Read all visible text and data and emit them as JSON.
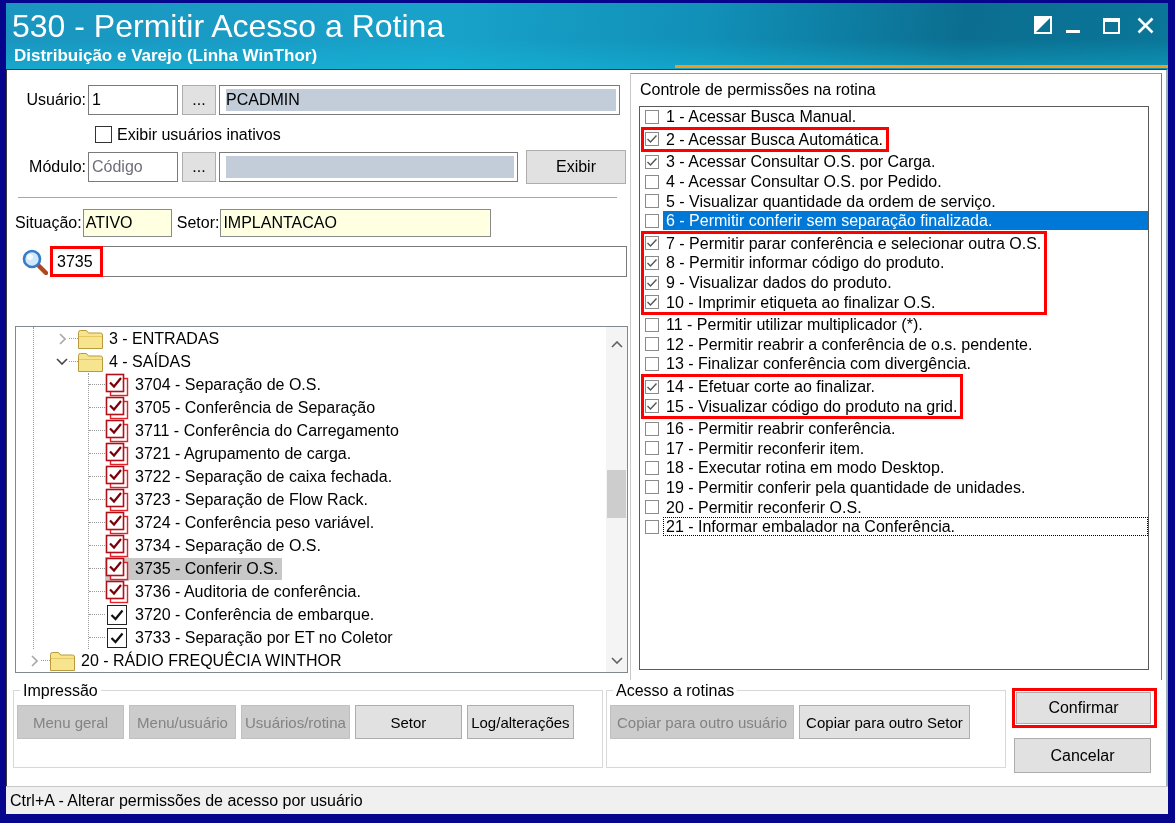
{
  "window": {
    "title": "530 - Permitir Acesso a Rotina",
    "subtitle": "Distribuição e Varejo (Linha WinThor)"
  },
  "user": {
    "label": "Usuário:",
    "code": "1",
    "lookup": "...",
    "name": "PCADMIN"
  },
  "show_inactive": {
    "label": "Exibir usuários inativos",
    "checked": false
  },
  "module": {
    "label": "Módulo:",
    "code": {
      "placeholder": "Código"
    },
    "lookup": "...",
    "show_button": "Exibir"
  },
  "situation": {
    "label": "Situação:",
    "value": "ATIVO"
  },
  "sector": {
    "label": "Setor:",
    "value": "IMPLANTACAO"
  },
  "search": {
    "value": "3735",
    "highlighted": true
  },
  "tree": {
    "items": [
      {
        "children": [
          {
            "kind": "folder",
            "label": "3 - ENTRADAS",
            "expanded": false,
            "selected": false
          },
          {
            "kind": "folder",
            "label": "4 - SAÍDAS",
            "expanded": true,
            "selected": false,
            "children": [
              {
                "kind": "double",
                "label": "3704 - Separação de O.S.",
                "checked": true,
                "selected": false
              },
              {
                "kind": "double",
                "label": "3705 - Conferência de Separação",
                "checked": true,
                "selected": false
              },
              {
                "kind": "double",
                "label": "3711 - Conferência do Carregamento",
                "checked": true,
                "selected": false
              },
              {
                "kind": "double",
                "label": "3721 - Agrupamento de carga.",
                "checked": true,
                "selected": false
              },
              {
                "kind": "double",
                "label": "3722 - Separação de caixa fechada.",
                "checked": true,
                "selected": false
              },
              {
                "kind": "double",
                "label": "3723 - Separação de Flow Rack.",
                "checked": true,
                "selected": false
              },
              {
                "kind": "double",
                "label": "3724 - Conferência peso variável.",
                "checked": true,
                "selected": false
              },
              {
                "kind": "double",
                "label": "3734 - Separação de O.S.",
                "checked": true,
                "selected": false
              },
              {
                "kind": "double",
                "label": "3735 - Conferir O.S.",
                "checked": true,
                "selected": true
              },
              {
                "kind": "double",
                "label": "3736 - Auditoria de conferência.",
                "checked": true,
                "selected": false
              },
              {
                "kind": "single",
                "label": "3720 - Conferência de embarque.",
                "checked": true,
                "selected": false
              },
              {
                "kind": "single",
                "label": "3733 - Separação por ET no Coletor",
                "checked": true,
                "selected": false
              }
            ]
          }
        ]
      },
      {
        "kind": "folder",
        "label": "20 - RÁDIO FREQUÊCIA WINTHOR",
        "expanded": false,
        "selected": false
      }
    ]
  },
  "permissions": {
    "title": "Controle de permissões na rotina",
    "items": [
      {
        "label": "1 - Acessar Busca Manual.",
        "checked": false,
        "selected": false,
        "focused": false,
        "highlighted": false
      },
      {
        "label": "2 - Acessar Busca Automática.",
        "checked": true,
        "selected": false,
        "focused": false,
        "highlighted": true
      },
      {
        "label": "3 - Acessar Consultar O.S. por Carga.",
        "checked": true,
        "selected": false,
        "focused": false,
        "highlighted": false
      },
      {
        "label": "4 - Acessar Consultar O.S. por Pedido.",
        "checked": false,
        "selected": false,
        "focused": false,
        "highlighted": false
      },
      {
        "label": "5 - Visualizar quantidade da ordem de serviço.",
        "checked": false,
        "selected": false,
        "focused": false,
        "highlighted": false
      },
      {
        "label": "6 - Permitir conferir sem separação finalizada.",
        "checked": false,
        "selected": true,
        "focused": false,
        "highlighted": false
      },
      {
        "label": "7 - Permitir parar conferência e selecionar outra O.S.",
        "checked": true,
        "selected": false,
        "focused": false,
        "highlighted": true
      },
      {
        "label": "8 - Permitir informar código do produto.",
        "checked": true,
        "selected": false,
        "focused": false,
        "highlighted": true
      },
      {
        "label": "9 - Visualizar dados do produto.",
        "checked": true,
        "selected": false,
        "focused": false,
        "highlighted": true
      },
      {
        "label": "10 - Imprimir etiqueta ao finalizar O.S.",
        "checked": true,
        "selected": false,
        "focused": false,
        "highlighted": true
      },
      {
        "label": "11 - Permitir utilizar multiplicador (*).",
        "checked": false,
        "selected": false,
        "focused": false,
        "highlighted": false
      },
      {
        "label": "12 - Permitir reabrir a conferência de o.s. pendente.",
        "checked": false,
        "selected": false,
        "focused": false,
        "highlighted": false
      },
      {
        "label": "13 - Finalizar conferência com divergência.",
        "checked": false,
        "selected": false,
        "focused": false,
        "highlighted": false
      },
      {
        "label": "14 - Efetuar corte ao finalizar.",
        "checked": true,
        "selected": false,
        "focused": false,
        "highlighted": true
      },
      {
        "label": "15 - Visualizar código do produto na grid.",
        "checked": true,
        "selected": false,
        "focused": false,
        "highlighted": true
      },
      {
        "label": "16 - Permitir reabrir conferência.",
        "checked": false,
        "selected": false,
        "focused": false,
        "highlighted": false
      },
      {
        "label": "17 - Permitir reconferir item.",
        "checked": false,
        "selected": false,
        "focused": false,
        "highlighted": false
      },
      {
        "label": "18 - Executar rotina em modo Desktop.",
        "checked": false,
        "selected": false,
        "focused": false,
        "highlighted": false
      },
      {
        "label": "19 - Permitir conferir pela quantidade de unidades.",
        "checked": false,
        "selected": false,
        "focused": false,
        "highlighted": false
      },
      {
        "label": "20 - Permitir reconferir O.S.",
        "checked": false,
        "selected": false,
        "focused": false,
        "highlighted": false
      },
      {
        "label": "21 - Informar embalador na Conferência.",
        "checked": false,
        "selected": false,
        "focused": true,
        "highlighted": false
      }
    ]
  },
  "printing": {
    "title": "Impressão",
    "buttons": [
      {
        "label": "Menu geral",
        "disabled": true
      },
      {
        "label": "Menu/usuário",
        "disabled": true
      },
      {
        "label": "Usuários/rotina",
        "disabled": true
      },
      {
        "label": "Setor",
        "disabled": false
      },
      {
        "label": "Log/alterações",
        "disabled": false
      }
    ]
  },
  "routine_access": {
    "title": "Acesso a rotinas",
    "buttons": [
      {
        "label": "Copiar para outro usuário",
        "disabled": true
      },
      {
        "label": "Copiar para outro Setor",
        "disabled": false
      }
    ]
  },
  "actions": [
    {
      "label": "Confirmar",
      "highlighted": true
    },
    {
      "label": "Cancelar",
      "highlighted": false
    }
  ],
  "status_bar": {
    "text": "Ctrl+A - Alterar permissões de acesso por usuário"
  }
}
